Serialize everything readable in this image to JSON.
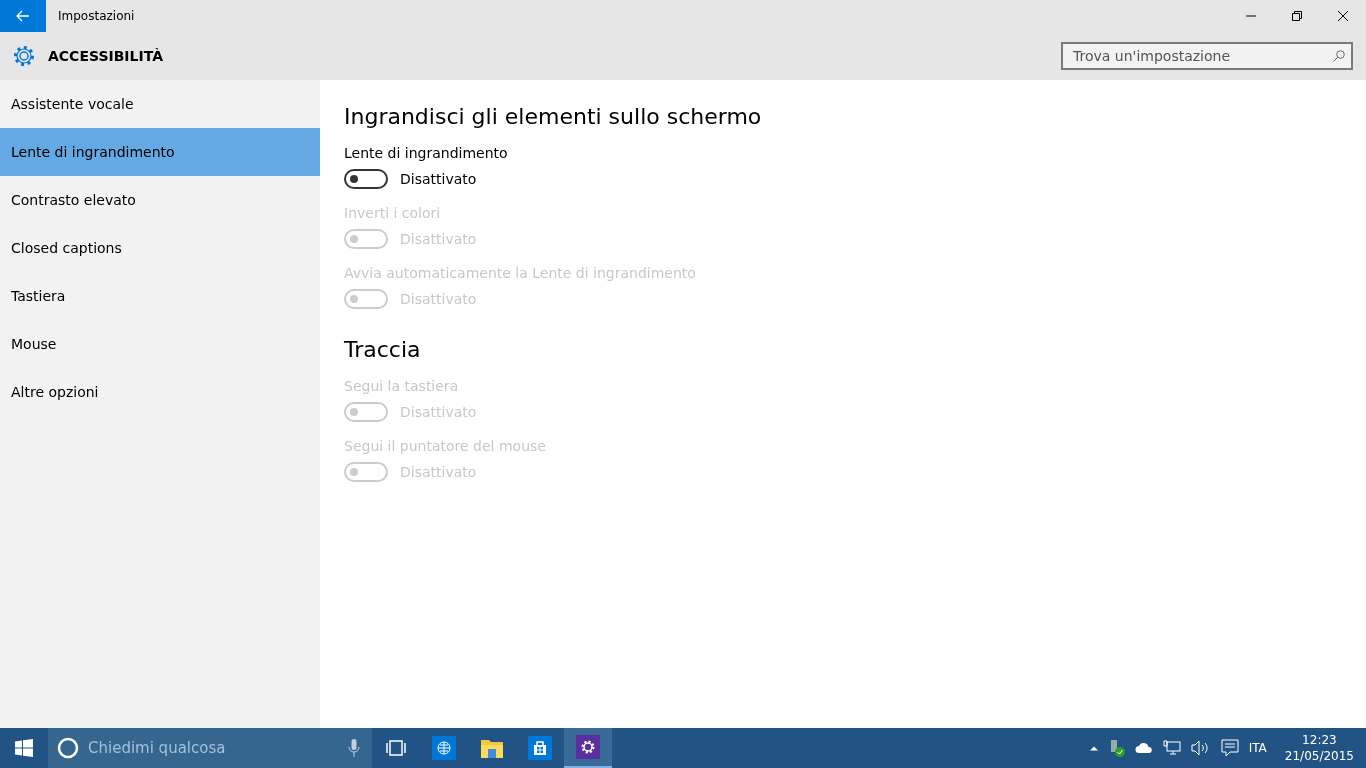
{
  "window": {
    "title": "Impostazioni"
  },
  "header": {
    "title": "ACCESSIBILITÀ",
    "search": {
      "placeholder": "Trova un'impostazione"
    }
  },
  "sidebar": {
    "items": [
      {
        "label": "Assistente vocale",
        "selected": false
      },
      {
        "label": "Lente di ingrandimento",
        "selected": true
      },
      {
        "label": "Contrasto elevato",
        "selected": false
      },
      {
        "label": "Closed captions",
        "selected": false
      },
      {
        "label": "Tastiera",
        "selected": false
      },
      {
        "label": "Mouse",
        "selected": false
      },
      {
        "label": "Altre opzioni",
        "selected": false
      }
    ]
  },
  "sections": [
    {
      "title": "Ingrandisci gli elementi sullo schermo",
      "settings": [
        {
          "label": "Lente di ingrandimento",
          "on": false,
          "disabled": false,
          "state": "Disattivato"
        },
        {
          "label": "Inverti i colori",
          "on": false,
          "disabled": true,
          "state": "Disattivato"
        },
        {
          "label": "Avvia automaticamente la Lente di ingrandimento",
          "on": false,
          "disabled": true,
          "state": "Disattivato"
        }
      ]
    },
    {
      "title": "Traccia",
      "settings": [
        {
          "label": "Segui la tastiera",
          "on": false,
          "disabled": true,
          "state": "Disattivato"
        },
        {
          "label": "Segui il puntatore del mouse",
          "on": false,
          "disabled": true,
          "state": "Disattivato"
        }
      ]
    }
  ],
  "taskbar": {
    "search": {
      "placeholder": "Chiedimi qualcosa"
    },
    "apps": [
      {
        "kind": "taskview",
        "selected": false
      },
      {
        "kind": "browser",
        "selected": false
      },
      {
        "kind": "explorer",
        "selected": false
      },
      {
        "kind": "store",
        "selected": false
      },
      {
        "kind": "settings",
        "selected": true
      }
    ],
    "language": "ITA",
    "time": "12:23",
    "date": "21/05/2015"
  }
}
